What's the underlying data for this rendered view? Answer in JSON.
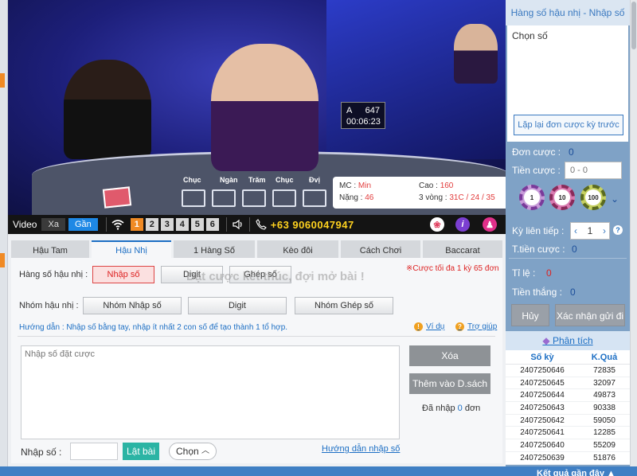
{
  "video": {
    "timer": {
      "label": "A",
      "count": "647",
      "time": "00:06:23"
    },
    "card_labels": [
      "Chục",
      "Ngàn",
      "Trăm",
      "Chục",
      "Đvị"
    ],
    "info": {
      "mc_label": "MC :",
      "mc_value": "Min",
      "tall_label": "Cao :",
      "tall_value": "160",
      "weight_label": "Nặng :",
      "weight_value": "46",
      "rounds_label": "3 vòng :",
      "rounds_value": "31C / 24 / 35"
    },
    "toolbar": {
      "video_label": "Video",
      "far_label": "Xa",
      "near_label": "Gần",
      "cams": [
        "1",
        "2",
        "3",
        "4",
        "5",
        "6"
      ],
      "active_cam": "1",
      "phone": "+63 9060047947"
    }
  },
  "tabs": [
    "Hậu Tam",
    "Hậu Nhị",
    "1 Hàng Số",
    "Kèo đôi",
    "Cách Chơi",
    "Baccarat"
  ],
  "active_tab": "Hậu Nhị",
  "bet": {
    "row1_label": "Hàng số hậu nhị :",
    "row1_buttons": [
      "Nhập số",
      "Digit",
      "Ghép số"
    ],
    "overlay": "Đặt cược kết thúc, đợi mở bài !",
    "limit": "※Cược tối đa 1 kỳ 65 đơn",
    "row2_label": "Nhóm hậu nhị :",
    "row2_buttons": [
      "Nhóm Nhập số",
      "Digit",
      "Nhóm Ghép số"
    ],
    "guide": "Hướng dẫn : Nhập số bằng tay, nhập ít nhất 2 con số để tạo thành 1 tổ hợp.",
    "example_link": "Ví dụ",
    "help_link": "Trợ giúp",
    "textarea_placeholder": "Nhập số đặt cược",
    "delete_label": "Xóa",
    "add_list_label": "Thêm vào D.sách",
    "count_prefix": "Đã nhập",
    "count_value": "0",
    "count_suffix": "đơn",
    "input_label": "Nhập số :",
    "flip_label": "Lật bài",
    "choose_label": "Chọn",
    "input_guide_link": "Hướng dẫn nhập số"
  },
  "side": {
    "title": "Hàng số hậu nhị - Nhập số",
    "chosen_label": "Chọn số",
    "repeat_label": "Lặp lại đơn cược kỳ trước",
    "unit_label": "Đơn cược :",
    "unit_value": "0",
    "amount_label": "Tiền cược :",
    "amount_placeholder": "0 - 0",
    "chips": [
      "1",
      "10",
      "100"
    ],
    "consecutive_label": "Kỳ liên tiếp :",
    "consecutive_value": "1",
    "total_label": "T.tiền cược :",
    "total_value": "0",
    "rate_label": "Tỉ lệ :",
    "rate_value": "0",
    "win_label": "Tiền thắng :",
    "win_value": "0",
    "cancel_label": "Hủy",
    "confirm_label": "Xác nhận gửi đi",
    "analysis_label": "Phân tích",
    "results_header": {
      "period": "Số kỳ",
      "result": "K.Quả"
    },
    "results": [
      {
        "period": "2407250646",
        "result": "72835"
      },
      {
        "period": "2407250645",
        "result": "32097"
      },
      {
        "period": "2407250644",
        "result": "49873"
      },
      {
        "period": "2407250643",
        "result": "90338"
      },
      {
        "period": "2407250642",
        "result": "59050"
      },
      {
        "period": "2407250641",
        "result": "12285"
      },
      {
        "period": "2407250640",
        "result": "55209"
      },
      {
        "period": "2407250639",
        "result": "51876"
      }
    ]
  },
  "footer": {
    "label": "Kết quả gần đây"
  },
  "colors": {
    "accent": "#1d6fc4",
    "orange": "#f08a24",
    "danger": "#d22222",
    "sidebar": "#7fa2c6"
  }
}
